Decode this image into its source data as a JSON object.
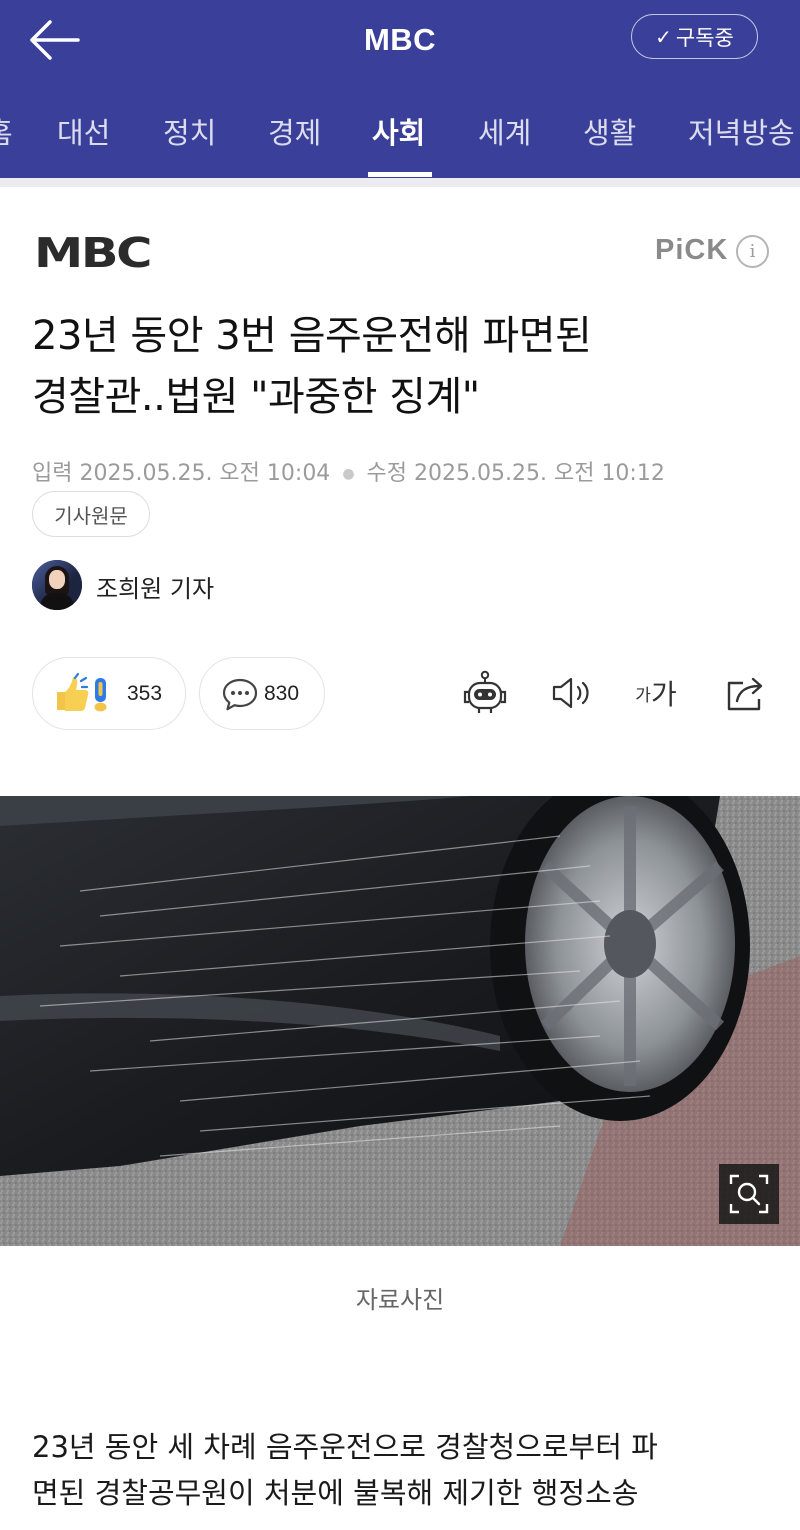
{
  "header": {
    "title": "MBC",
    "subscribe_label": "구독중"
  },
  "categories": [
    "홈",
    "대선",
    "정치",
    "경제",
    "사회",
    "세계",
    "생활",
    "저녁방송"
  ],
  "active_category": "사회",
  "article": {
    "press_logo_text": "MBC",
    "pick_label": "PiCK",
    "headline_line1": "23년 동안 3번 음주운전해 파면된",
    "headline_line2": "경찰관..법원 \"과중한 징계\"",
    "input_label": "입력",
    "input_date": "2025.05.25. 오전 10:04",
    "edit_label": "수정",
    "edit_date": "2025.05.25. 오전 10:12",
    "origin_button": "기사원문",
    "reporter": "조희원 기자",
    "reaction_count": "353",
    "comment_count": "830",
    "photo_caption": "자료사진",
    "body_line1": "23년 동안 세 차례 음주운전으로 경찰청으로부터 파",
    "body_line2": "면된 경찰공무원이 처분에 불복해 제기한 행정소송"
  },
  "colors": {
    "brand": "#3a3f9a",
    "text": "#111111",
    "muted": "#9b9b9b"
  },
  "icons": [
    "back-arrow-icon",
    "check-icon",
    "info-icon",
    "reaction-icon",
    "comment-icon",
    "summary-bot-icon",
    "speaker-icon",
    "font-size-icon",
    "share-icon",
    "zoom-icon"
  ]
}
